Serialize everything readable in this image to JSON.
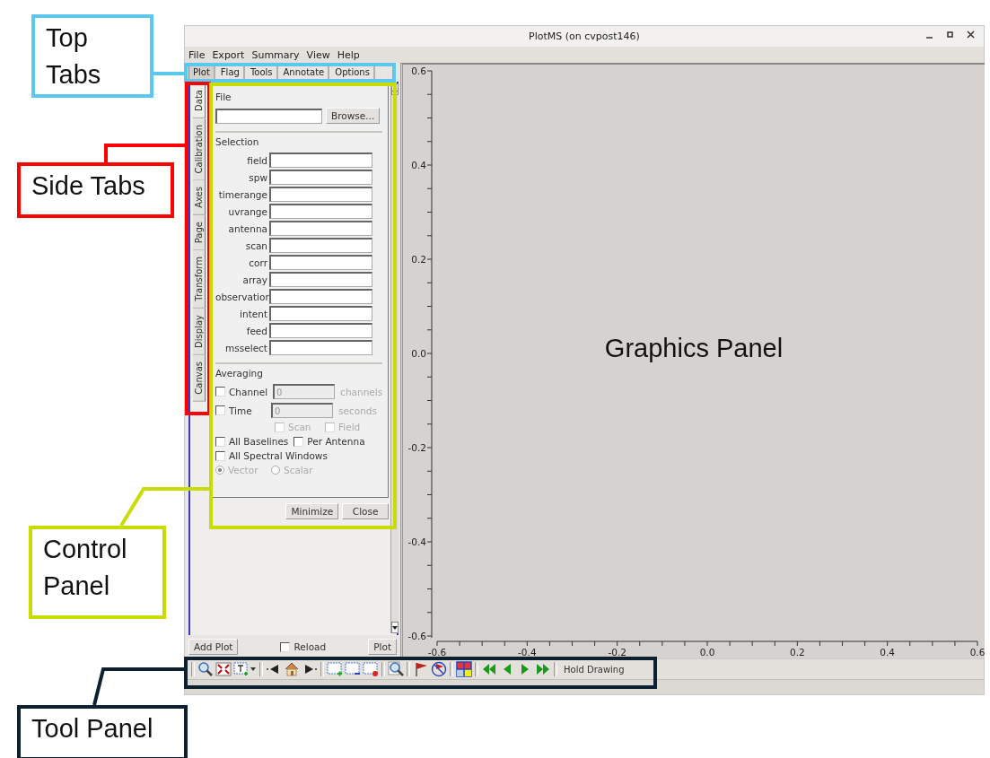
{
  "annotations": [
    {
      "label": "Top Tabs",
      "color": "#5bc8ef"
    },
    {
      "label": "Side Tabs",
      "color": "#ff0000"
    },
    {
      "label": "Control Panel",
      "color": "#c8dc00"
    },
    {
      "label": "Tool Panel",
      "color": "#0d2030"
    }
  ],
  "window": {
    "title": "PlotMS (on cvpost146)"
  },
  "menu": [
    "File",
    "Export",
    "Summary",
    "View",
    "Help"
  ],
  "top_tabs": [
    {
      "label": "Plot",
      "selected": true
    },
    {
      "label": "Flag",
      "selected": false
    },
    {
      "label": "Tools",
      "selected": false
    },
    {
      "label": "Annotate",
      "selected": false
    },
    {
      "label": "Options",
      "selected": false
    }
  ],
  "side_tabs": [
    {
      "label": "Data",
      "selected": true
    },
    {
      "label": "Calibration",
      "selected": false
    },
    {
      "label": "Axes",
      "selected": false
    },
    {
      "label": "Page",
      "selected": false
    },
    {
      "label": "Transform",
      "selected": false
    },
    {
      "label": "Display",
      "selected": false
    },
    {
      "label": "Canvas",
      "selected": false
    }
  ],
  "file": {
    "heading": "File",
    "browse": "Browse..."
  },
  "selection": {
    "heading": "Selection",
    "fields": [
      "field",
      "spw",
      "timerange",
      "uvrange",
      "antenna",
      "scan",
      "corr",
      "array",
      "observation",
      "intent",
      "feed",
      "msselect"
    ]
  },
  "averaging": {
    "heading": "Averaging",
    "amounts": [
      {
        "label": "Channel",
        "checked": false,
        "value": "0",
        "unit": "channels",
        "disabled": true
      },
      {
        "label": "Time",
        "checked": false,
        "value": "0",
        "unit": "seconds",
        "disabled": true
      }
    ],
    "sub_options": [
      {
        "label": "Scan",
        "checked": false,
        "disabled": true
      },
      {
        "label": "Field",
        "checked": false,
        "disabled": true
      }
    ],
    "baselines": [
      {
        "label": "All Baselines",
        "checked": false,
        "disabled": false
      },
      {
        "label": "Per Antenna",
        "checked": false,
        "disabled": false
      }
    ],
    "spectral": {
      "label": "All Spectral Windows",
      "checked": false,
      "disabled": false
    },
    "modes": [
      {
        "label": "Vector",
        "selected": true,
        "disabled": true
      },
      {
        "label": "Scalar",
        "selected": false,
        "disabled": true
      }
    ]
  },
  "panel_buttons": [
    "Minimize",
    "Close"
  ],
  "bottom": {
    "add_plot": "Add Plot",
    "reload": {
      "label": "Reload",
      "checked": false
    },
    "plot": "Plot"
  },
  "graphics": {
    "label": "Graphics Panel",
    "chart_data": {
      "type": "scatter",
      "xlim": [
        -0.6,
        0.6
      ],
      "ylim": [
        -0.6,
        0.6
      ],
      "xticks": [
        {
          "value": -0.6,
          "label": "-0.6"
        },
        {
          "value": -0.4,
          "label": "-0.4"
        },
        {
          "value": -0.2,
          "label": "-0.2"
        },
        {
          "value": 0,
          "label": "0.0"
        },
        {
          "value": 0.2,
          "label": "0.2"
        },
        {
          "value": 0.4,
          "label": "0.4"
        },
        {
          "value": 0.6,
          "label": "0.6"
        }
      ],
      "yticks": [
        {
          "value": -0.6,
          "label": "-0.6"
        },
        {
          "value": -0.4,
          "label": "-0.4"
        },
        {
          "value": -0.2,
          "label": "-0.2"
        },
        {
          "value": 0,
          "label": "0.0"
        },
        {
          "value": 0.2,
          "label": "0.2"
        },
        {
          "value": 0.4,
          "label": "0.4"
        },
        {
          "value": 0.6,
          "label": "0.6"
        }
      ]
    }
  },
  "toolbar": {
    "hold_drawing": "Hold Drawing"
  }
}
